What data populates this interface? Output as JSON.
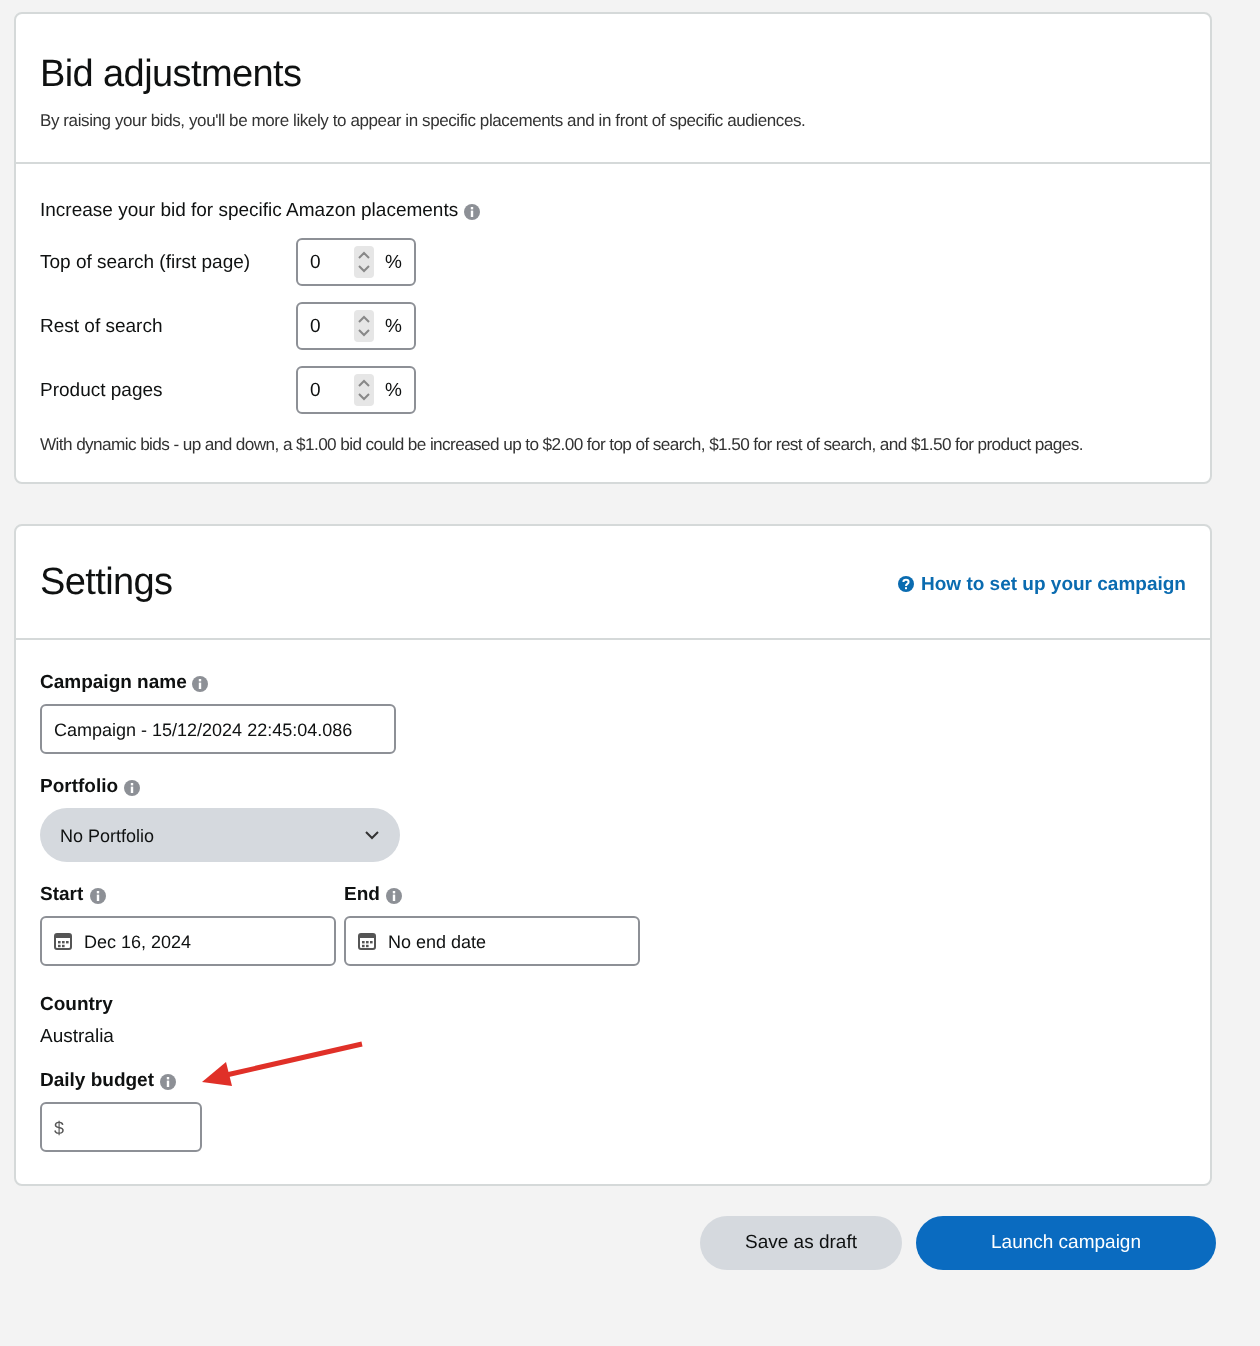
{
  "bid_adjustments": {
    "title": "Bid adjustments",
    "description": "By raising your bids, you'll be more likely to appear in specific placements and in front of specific audiences.",
    "placements_label": "Increase your bid for specific Amazon placements",
    "placements_info": true,
    "placements": [
      {
        "label": "Top of search (first page)",
        "value": "0",
        "unit": "%"
      },
      {
        "label": "Rest of search",
        "value": "0",
        "unit": "%"
      },
      {
        "label": "Product pages",
        "value": "0",
        "unit": "%"
      }
    ],
    "note": "With dynamic bids - up and down, a $1.00 bid could be increased up to $2.00 for top of search, $1.50 for rest of search, and $1.50 for product pages."
  },
  "settings": {
    "title": "Settings",
    "help_link": "How to set up your campaign",
    "campaign_name": {
      "label": "Campaign name",
      "info": true,
      "value": "Campaign - 15/12/2024 22:45:04.086"
    },
    "portfolio": {
      "label": "Portfolio",
      "info": true,
      "value": "No Portfolio"
    },
    "start": {
      "label": "Start",
      "info": true,
      "value": "Dec 16, 2024"
    },
    "end": {
      "label": "End",
      "info": true,
      "value": "No end date"
    },
    "country": {
      "label": "Country",
      "info": false,
      "value": "Australia"
    },
    "daily_budget": {
      "label": "Daily budget",
      "info": true,
      "prefix": "$"
    }
  },
  "buttons": [
    {
      "label": "Save as draft",
      "kind": "secondary"
    },
    {
      "label": "Launch campaign",
      "kind": "primary"
    }
  ]
}
